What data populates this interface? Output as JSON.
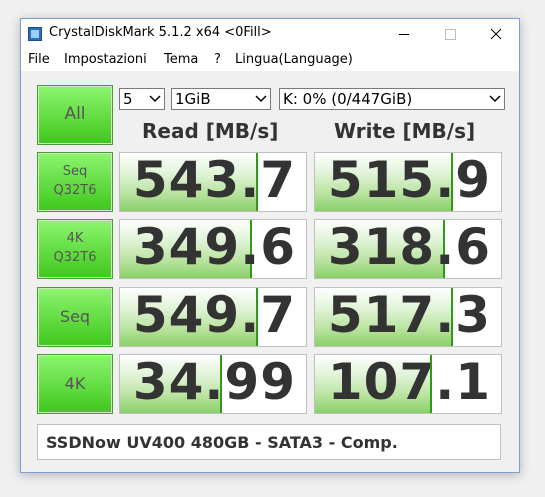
{
  "window": {
    "title": "CrystalDiskMark 5.1.2 x64 <0Fill>"
  },
  "menu": [
    "File",
    "Impostazioni",
    "Tema",
    "?",
    "Lingua(Language)"
  ],
  "controls": {
    "all_label": "All",
    "count_value": "5",
    "size_value": "1GiB",
    "drive_value": "K: 0% (0/447GiB)"
  },
  "headers": {
    "read": "Read [MB/s]",
    "write": "Write [MB/s]"
  },
  "tests": [
    {
      "line1": "Seq",
      "line2": "Q32T6",
      "read": "543.7",
      "write": "515.9",
      "read_fraction": 0.74,
      "write_fraction": 0.74
    },
    {
      "line1": "4K",
      "line2": "Q32T6",
      "read": "349.6",
      "write": "318.6",
      "read_fraction": 0.71,
      "write_fraction": 0.7
    },
    {
      "line1": "Seq",
      "line2": "",
      "read": "549.7",
      "write": "517.3",
      "read_fraction": 0.74,
      "write_fraction": 0.74
    },
    {
      "line1": "4K",
      "line2": "",
      "read": "34.99",
      "write": "107.1",
      "read_fraction": 0.55,
      "write_fraction": 0.63
    }
  ],
  "comment": "SSDNow UV400 480GB - SATA3 - Comp.",
  "colors": {
    "accent_green": "#3fc71c",
    "bar_edge": "#2e9a15"
  }
}
